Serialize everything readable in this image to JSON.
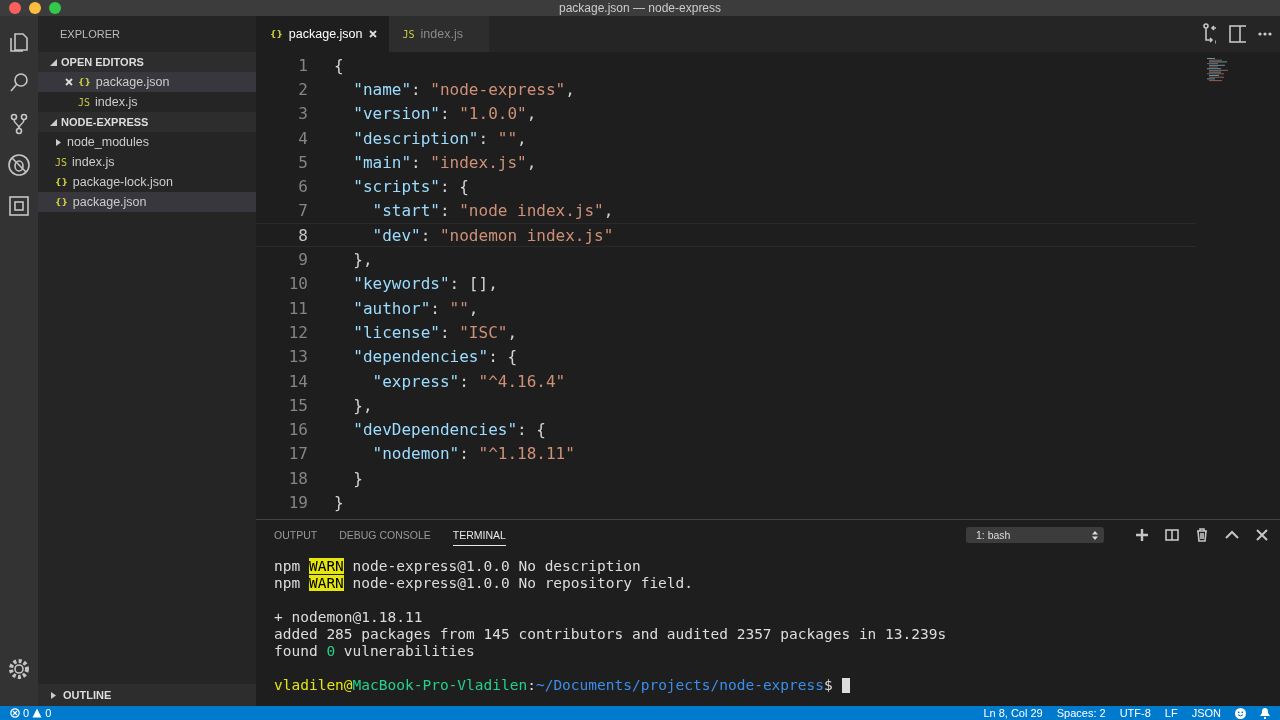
{
  "window": {
    "title": "package.json — node-express"
  },
  "sidebar": {
    "title": "EXPLORER",
    "sections": [
      {
        "title": "OPEN EDITORS",
        "expanded": true,
        "items": [
          {
            "label": "package.json",
            "kind": "json",
            "icon": "{}",
            "selected": true,
            "close": true
          },
          {
            "label": "index.js",
            "kind": "js",
            "icon": "JS",
            "selected": false,
            "close": false
          }
        ]
      },
      {
        "title": "NODE-EXPRESS",
        "expanded": true,
        "items": [
          {
            "label": "node_modules",
            "kind": "folder",
            "selected": false,
            "expanded": false
          },
          {
            "label": "index.js",
            "kind": "js",
            "icon": "JS",
            "selected": false
          },
          {
            "label": "package-lock.json",
            "kind": "json",
            "icon": "{}",
            "selected": false
          },
          {
            "label": "package.json",
            "kind": "json",
            "icon": "{}",
            "selected": true
          }
        ]
      }
    ],
    "outline": {
      "title": "OUTLINE",
      "expanded": false
    }
  },
  "tabs": [
    {
      "label": "package.json",
      "kind": "json",
      "icon": "{}",
      "selected": true
    },
    {
      "label": "index.js",
      "kind": "js",
      "icon": "JS",
      "selected": false
    }
  ],
  "editor": {
    "lines": [
      {
        "number": "1",
        "current": false,
        "tokens": [
          {
            "kind": "punct",
            "text": "{"
          }
        ]
      },
      {
        "number": "2",
        "current": false,
        "tokens": [
          {
            "kind": "key",
            "text": "  \"name\""
          },
          {
            "kind": "punct",
            "text": ": "
          },
          {
            "kind": "string",
            "text": "\"node-express\""
          },
          {
            "kind": "punct",
            "text": ","
          }
        ]
      },
      {
        "number": "3",
        "current": false,
        "tokens": [
          {
            "kind": "key",
            "text": "  \"version\""
          },
          {
            "kind": "punct",
            "text": ": "
          },
          {
            "kind": "string",
            "text": "\"1.0.0\""
          },
          {
            "kind": "punct",
            "text": ","
          }
        ]
      },
      {
        "number": "4",
        "current": false,
        "tokens": [
          {
            "kind": "key",
            "text": "  \"description\""
          },
          {
            "kind": "punct",
            "text": ": "
          },
          {
            "kind": "string",
            "text": "\"\""
          },
          {
            "kind": "punct",
            "text": ","
          }
        ]
      },
      {
        "number": "5",
        "current": false,
        "tokens": [
          {
            "kind": "key",
            "text": "  \"main\""
          },
          {
            "kind": "punct",
            "text": ": "
          },
          {
            "kind": "string",
            "text": "\"index.js\""
          },
          {
            "kind": "punct",
            "text": ","
          }
        ]
      },
      {
        "number": "6",
        "current": false,
        "tokens": [
          {
            "kind": "key",
            "text": "  \"scripts\""
          },
          {
            "kind": "punct",
            "text": ": {"
          }
        ]
      },
      {
        "number": "7",
        "current": false,
        "tokens": [
          {
            "kind": "key",
            "text": "    \"start\""
          },
          {
            "kind": "punct",
            "text": ": "
          },
          {
            "kind": "string",
            "text": "\"node index.js\""
          },
          {
            "kind": "punct",
            "text": ","
          }
        ]
      },
      {
        "number": "8",
        "current": true,
        "tokens": [
          {
            "kind": "key",
            "text": "    \"dev\""
          },
          {
            "kind": "punct",
            "text": ": "
          },
          {
            "kind": "string",
            "text": "\"nodemon index.js\""
          }
        ]
      },
      {
        "number": "9",
        "current": false,
        "tokens": [
          {
            "kind": "punct",
            "text": "  },"
          }
        ]
      },
      {
        "number": "10",
        "current": false,
        "tokens": [
          {
            "kind": "key",
            "text": "  \"keywords\""
          },
          {
            "kind": "punct",
            "text": ": [],"
          }
        ]
      },
      {
        "number": "11",
        "current": false,
        "tokens": [
          {
            "kind": "key",
            "text": "  \"author\""
          },
          {
            "kind": "punct",
            "text": ": "
          },
          {
            "kind": "string",
            "text": "\"\""
          },
          {
            "kind": "punct",
            "text": ","
          }
        ]
      },
      {
        "number": "12",
        "current": false,
        "tokens": [
          {
            "kind": "key",
            "text": "  \"license\""
          },
          {
            "kind": "punct",
            "text": ": "
          },
          {
            "kind": "string",
            "text": "\"ISC\""
          },
          {
            "kind": "punct",
            "text": ","
          }
        ]
      },
      {
        "number": "13",
        "current": false,
        "tokens": [
          {
            "kind": "key",
            "text": "  \"dependencies\""
          },
          {
            "kind": "punct",
            "text": ": {"
          }
        ]
      },
      {
        "number": "14",
        "current": false,
        "tokens": [
          {
            "kind": "key",
            "text": "    \"express\""
          },
          {
            "kind": "punct",
            "text": ": "
          },
          {
            "kind": "string",
            "text": "\"^4.16.4\""
          }
        ]
      },
      {
        "number": "15",
        "current": false,
        "tokens": [
          {
            "kind": "punct",
            "text": "  },"
          }
        ]
      },
      {
        "number": "16",
        "current": false,
        "tokens": [
          {
            "kind": "key",
            "text": "  \"devDependencies\""
          },
          {
            "kind": "punct",
            "text": ": {"
          }
        ]
      },
      {
        "number": "17",
        "current": false,
        "tokens": [
          {
            "kind": "key",
            "text": "    \"nodemon\""
          },
          {
            "kind": "punct",
            "text": ": "
          },
          {
            "kind": "string",
            "text": "\"^1.18.11\""
          }
        ]
      },
      {
        "number": "18",
        "current": false,
        "tokens": [
          {
            "kind": "punct",
            "text": "  }"
          }
        ]
      },
      {
        "number": "19",
        "current": false,
        "tokens": [
          {
            "kind": "punct",
            "text": "}"
          }
        ]
      }
    ]
  },
  "panel": {
    "tabs": [
      {
        "label": "OUTPUT",
        "selected": false
      },
      {
        "label": "DEBUG CONSOLE",
        "selected": false
      },
      {
        "label": "TERMINAL",
        "selected": true
      }
    ],
    "terminal_select": {
      "value": "1: bash"
    },
    "terminal": [
      {
        "gap_before": false,
        "cursor": false,
        "spans": [
          {
            "kind": "plain",
            "text": "npm "
          },
          {
            "kind": "warn",
            "text": "WARN"
          },
          {
            "kind": "plain",
            "text": " node-express@1.0.0 No description"
          }
        ]
      },
      {
        "gap_before": false,
        "cursor": false,
        "spans": [
          {
            "kind": "plain",
            "text": "npm "
          },
          {
            "kind": "warn",
            "text": "WARN"
          },
          {
            "kind": "plain",
            "text": " node-express@1.0.0 No repository field."
          }
        ]
      },
      {
        "gap_before": true,
        "cursor": false,
        "spans": [
          {
            "kind": "plain",
            "text": "+ nodemon@1.18.11"
          }
        ]
      },
      {
        "gap_before": false,
        "cursor": false,
        "spans": [
          {
            "kind": "plain",
            "text": "added 285 packages from 145 contributors and audited 2357 packages in 13.239s"
          }
        ]
      },
      {
        "gap_before": false,
        "cursor": false,
        "spans": [
          {
            "kind": "plain",
            "text": "found "
          },
          {
            "kind": "number",
            "text": "0"
          },
          {
            "kind": "plain",
            "text": " vulnerabilities"
          }
        ]
      },
      {
        "gap_before": true,
        "cursor": true,
        "spans": [
          {
            "kind": "user",
            "text": "vladilen@"
          },
          {
            "kind": "host",
            "text": "MacBook-Pro-Vladilen"
          },
          {
            "kind": "plain",
            "text": ":"
          },
          {
            "kind": "path",
            "text": "~/Documents/projects/node-express"
          },
          {
            "kind": "plain",
            "text": "$"
          }
        ]
      }
    ]
  },
  "status_bar": {
    "errors": "0",
    "warnings": "0",
    "items": [
      "Ln 8, Col 29",
      "Spaces: 2",
      "UTF-8",
      "LF",
      "JSON"
    ]
  }
}
